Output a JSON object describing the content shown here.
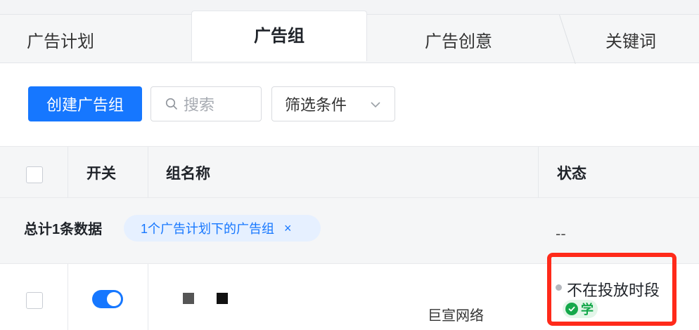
{
  "tabs": [
    {
      "label": "广告计划"
    },
    {
      "label": "广告组"
    },
    {
      "label": "广告创意"
    },
    {
      "label": "关键词"
    }
  ],
  "toolbar": {
    "create_label": "创建广告组",
    "search_placeholder": "搜索",
    "filter_label": "筛选条件"
  },
  "table": {
    "columns": [
      "开关",
      "组名称",
      "状态"
    ],
    "summary": {
      "total_text": "总计1条数据",
      "tag_text": "1个广告计划下的广告组",
      "tag_close": "×",
      "status_value": "--"
    },
    "rows": [
      {
        "enabled": true,
        "status": "不在投放时段",
        "badge": "学"
      }
    ]
  },
  "watermark": "巨宣网络",
  "colors": {
    "primary": "#1677ff",
    "highlight": "#ff2a1a",
    "badge_green": "#14a84a"
  }
}
